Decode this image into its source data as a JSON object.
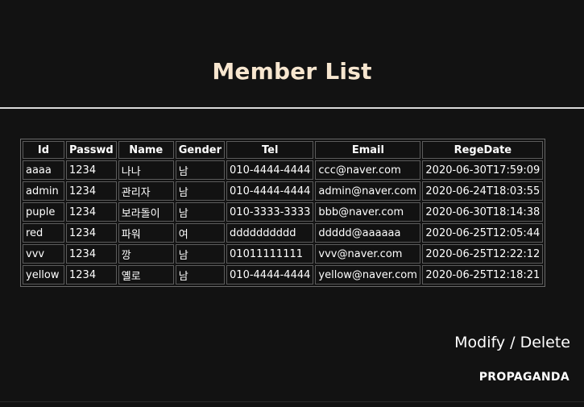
{
  "page": {
    "title": "Member List"
  },
  "table": {
    "headers": [
      "Id",
      "Passwd",
      "Name",
      "Gender",
      "Tel",
      "Email",
      "RegeDate"
    ],
    "rows": [
      [
        "aaaa",
        "1234",
        "나나",
        "남",
        "010-4444-4444",
        "ccc@naver.com",
        "2020-06-30T17:59:09"
      ],
      [
        "admin",
        "1234",
        "관리자",
        "남",
        "010-4444-4444",
        "admin@naver.com",
        "2020-06-24T18:03:55"
      ],
      [
        "puple",
        "1234",
        "보라돌이",
        "남",
        "010-3333-3333",
        "bbb@naver.com",
        "2020-06-30T18:14:38"
      ],
      [
        "red",
        "1234",
        "파워",
        "여",
        "dddddddddd",
        "ddddd@aaaaaa",
        "2020-06-25T12:05:44"
      ],
      [
        "vvv",
        "1234",
        "깡",
        "남",
        "01011111111",
        "vvv@naver.com",
        "2020-06-25T12:22:12"
      ],
      [
        "yellow",
        "1234",
        "옐로",
        "남",
        "010-4444-4444",
        "yellow@naver.com",
        "2020-06-25T12:18:21"
      ]
    ]
  },
  "actions": {
    "modify_label": "Modify",
    "separator": " / ",
    "delete_label": "Delete"
  },
  "footer": {
    "brand": "PROPAGANDA"
  },
  "colors": {
    "background": "#121212",
    "title": "#f7e6cf",
    "divider": "#d9d9d9"
  }
}
